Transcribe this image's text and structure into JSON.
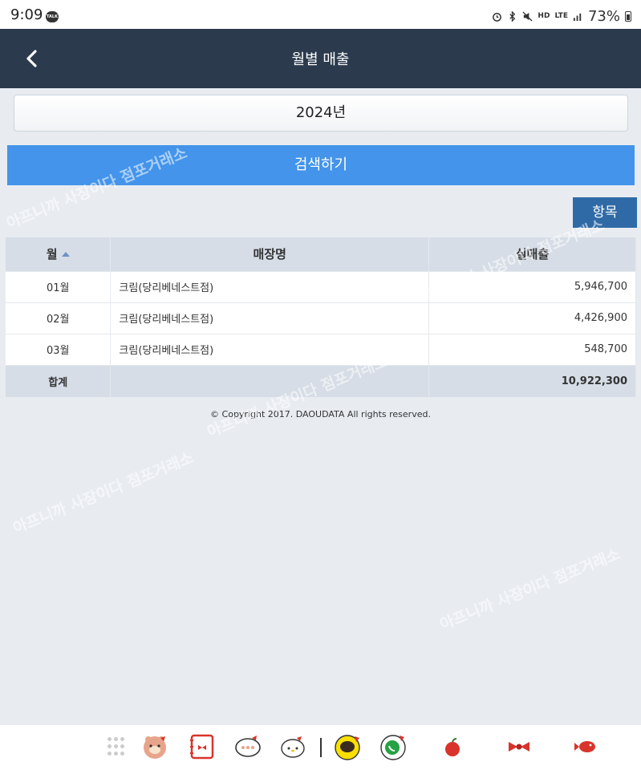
{
  "status_bar": {
    "time": "9:09",
    "talk_badge": "TALK",
    "hd": "HD",
    "lte": "LTE",
    "battery": "73%"
  },
  "header": {
    "title": "월별 매출"
  },
  "filter": {
    "year": "2024년",
    "search_label": "검색하기",
    "columns_label": "항목"
  },
  "table": {
    "headers": [
      "월",
      "매장명",
      "실매출"
    ],
    "rows": [
      {
        "month": "01월",
        "store": "크림(당리베네스트점)",
        "sales": "5,946,700"
      },
      {
        "month": "02월",
        "store": "크림(당리베네스트점)",
        "sales": "4,426,900"
      },
      {
        "month": "03월",
        "store": "크림(당리베네스트점)",
        "sales": "548,700"
      }
    ],
    "total": {
      "label": "합계",
      "store": "",
      "sales": "10,922,300"
    }
  },
  "footer": {
    "copyright": "© Copyright 2017. DAOUDATA All rights reserved."
  },
  "watermark": "아프니까 사장이다 점포거래소",
  "colors": {
    "header_bg": "#2b3a4d",
    "search_bg": "#4394ea",
    "columns_btn_bg": "#2f6aa6",
    "table_header_bg": "#d6dde6",
    "page_bg": "#e8ecf1"
  },
  "dock": {
    "apps": [
      "apps-grid-icon",
      "bear-app-icon",
      "notebook-app-icon",
      "chat-bubble-app-icon",
      "kitty-app-icon",
      "kakaotalk-icon",
      "whatsapp-icon",
      "apple-icon",
      "ribbon-icon",
      "fish-icon"
    ]
  }
}
